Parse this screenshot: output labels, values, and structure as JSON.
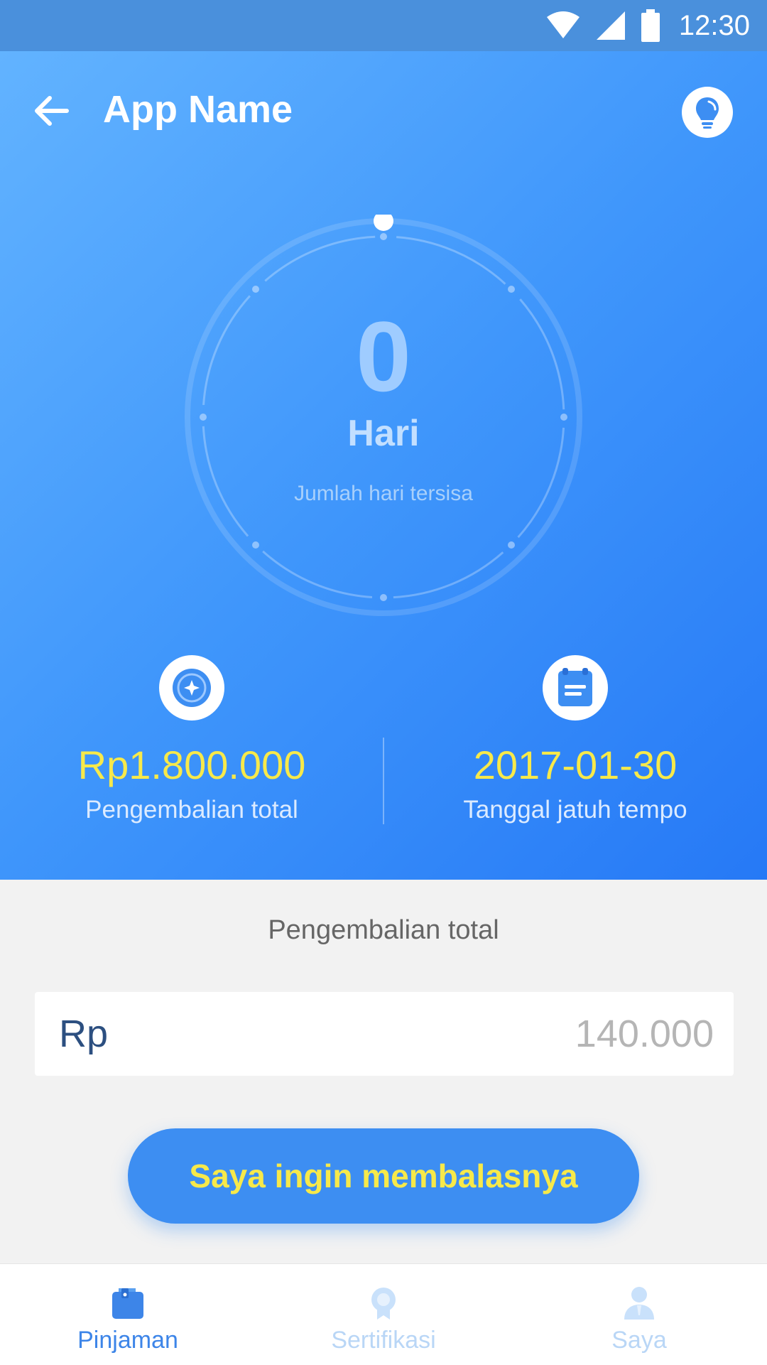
{
  "status_bar": {
    "time": "12:30"
  },
  "app_bar": {
    "title": "App Name"
  },
  "countdown": {
    "value": "0",
    "unit": "Hari",
    "caption": "Jumlah hari tersisa"
  },
  "summary": {
    "total": {
      "value": "Rp1.800.000",
      "label": "Pengembalian total"
    },
    "due_date": {
      "value": "2017-01-30",
      "label": "Tanggal jatuh tempo"
    }
  },
  "repayment": {
    "section_title": "Pengembalian total",
    "currency": "Rp",
    "amount_placeholder": "140.000"
  },
  "cta": {
    "label": "Saya ingin membalasnya"
  },
  "bottom_nav": {
    "items": [
      {
        "label": "Pinjaman",
        "icon": "wallet-icon",
        "active": true
      },
      {
        "label": "Sertifikasi",
        "icon": "badge-icon",
        "active": false
      },
      {
        "label": "Saya",
        "icon": "person-icon",
        "active": false
      }
    ]
  },
  "colors": {
    "primary": "#3d8ef2",
    "highlight": "#f7e94a",
    "hero_start": "#62b3ff",
    "hero_end": "#2679f6"
  }
}
